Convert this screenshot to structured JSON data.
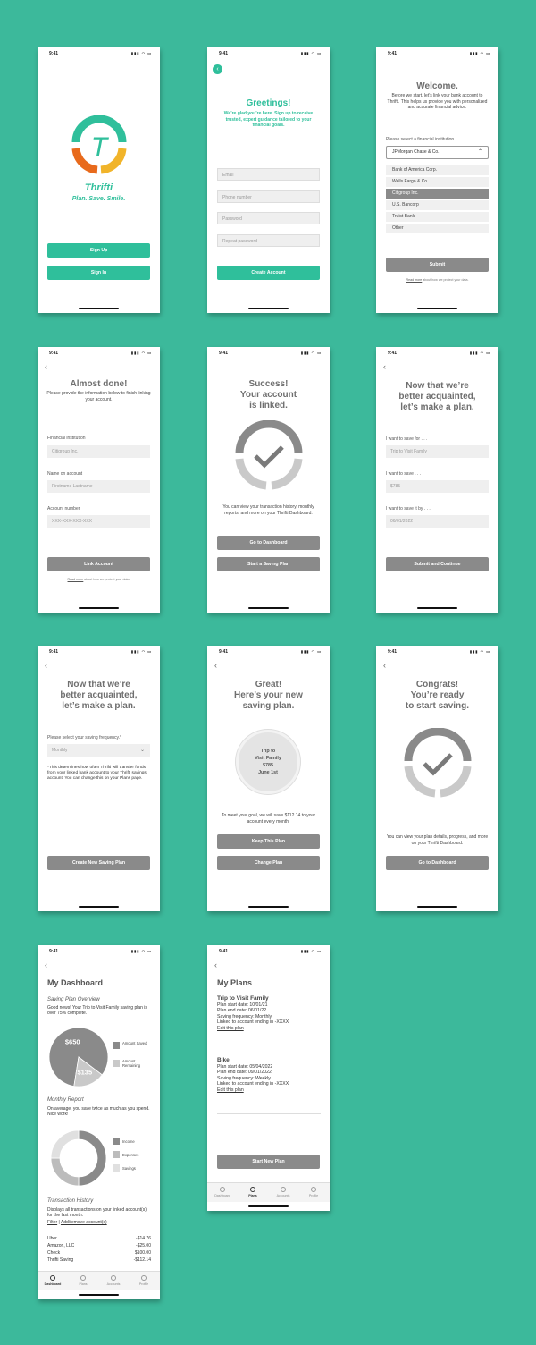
{
  "status": {
    "time": "9:41",
    "indicators": "▮▮▮ ◠ ▭"
  },
  "s1": {
    "logo_letter": "T",
    "app_name": "Thrifti",
    "tagline": "Plan. Save. Smile.",
    "signup": "Sign Up",
    "signin": "Sign In"
  },
  "s2": {
    "title": "Greetings!",
    "subtitle": "We’re glad you’re here. Sign up to receive trusted, expert guidance tailored to your financial goals.",
    "email": "Email",
    "phone": "Phone number",
    "password": "Password",
    "repeat": "Repeat password",
    "create": "Create Account"
  },
  "s3": {
    "title": "Welcome.",
    "intro": "Before we start, let’s link your bank account to Thrifti. This helps us provide you with personalized and accurate financial advice.",
    "select_label": "Please select a financial institution",
    "selected": "JPMorgan Chase & Co.",
    "options": [
      "Bank of America Corp.",
      "Wells Fargo & Co.",
      "Citigroup Inc.",
      "U.S. Bancorp",
      "Truist Bank",
      "Other"
    ],
    "submit": "Submit",
    "note_link": "Read more",
    "note_rest": " about how we protect your data."
  },
  "s4": {
    "title": "Almost done!",
    "intro": "Please provide the information below to finish linking your account.",
    "l1": "Financial institution",
    "v1": "Citigroup Inc.",
    "l2": "Name on account",
    "v2": "Firstname Lastname",
    "l3": "Account number",
    "v3": "XXX-XXX-XXX-XXX",
    "link": "Link Account",
    "note_link": "Read more",
    "note_rest": " about how we protect your data."
  },
  "s5": {
    "title1": "Success!",
    "title2": "Your account",
    "title3": "is linked.",
    "text": "You can view your transaction history, monthly reports, and more on your Thrifti Dashboard.",
    "dash": "Go to Dashboard",
    "start": "Start a Saving Plan"
  },
  "s6": {
    "title1": "Now that we’re",
    "title2": "better acquainted,",
    "title3": "let’s make a plan.",
    "l1": "I want to save for . . .",
    "v1": "Trip to Visit Family",
    "l2": "I want to save . . .",
    "v2": "$785",
    "l3": "I want to save it by . . .",
    "v3": "06/01/2022",
    "submit": "Submit and Continue"
  },
  "s7": {
    "title1": "Now that we’re",
    "title2": "better acquainted,",
    "title3": "let’s make a plan.",
    "label": "Please select your saving frequency.*",
    "value": "Monthly",
    "note": "*This determines how often Thrifti will transfer funds from your linked bank account to your Thrifti savings account. You can change this on your Plans page.",
    "create": "Create New Saving Plan"
  },
  "s8": {
    "title1": "Great!",
    "title2": "Here’s your new",
    "title3": "saving plan.",
    "c1": "Trip to",
    "c2": "Visit Family",
    "c3": "$785",
    "c4": "June 1st",
    "text": "To meet your goal, we will save $112.14 to your account every month.",
    "keep": "Keep This Plan",
    "change": "Change Plan"
  },
  "s9": {
    "title1": "Congrats!",
    "title2": "You’re ready",
    "title3": "to start saving.",
    "text": "You can view your plan details, progress, and more on your Thrifti Dashboard.",
    "dash": "Go to Dashboard"
  },
  "s10": {
    "title": "My Dashboard",
    "overview": "Saving Plan Overview",
    "overview_text": "Good news! Your Trip to Visit Family saving plan is over 75% complete.",
    "monthly": "Monthly Report",
    "monthly_text": "On average, you save twice as much as you spend. Nice work!",
    "history": "Transaction History",
    "history_text": "Displays all transactions on your linked account(s) for the last month.",
    "filter": "Filter",
    "sep": " | ",
    "add": "Add/remove account(s)",
    "transactions": [
      {
        "name": "Uber",
        "amount": "-$14.76"
      },
      {
        "name": "Amazon, LLC",
        "amount": "-$25.00"
      },
      {
        "name": "Check",
        "amount": "$100.00"
      },
      {
        "name": "Thrifti Saving",
        "amount": "-$112.14"
      }
    ],
    "tabs": [
      "Dashboard",
      "Plans",
      "Accounts",
      "Profile"
    ]
  },
  "s11": {
    "title": "My Plans",
    "plan1": {
      "name": "Trip to Visit Family",
      "l1": "Plan start date: 10/01/21",
      "l2": "Plan end date: 06/01/22",
      "l3": "Saving frequency: Monthly",
      "l4": "Linked to account ending in -XXXX",
      "edit": "Edit this plan"
    },
    "plan2": {
      "name": "Bike",
      "l1": "Plan start date: 05/04/2022",
      "l2": "Plan end date: 09/01/2022",
      "l3": "Saving frequency: Weekly",
      "l4": "Linked to account ending in -XXXX",
      "edit": "Edit this plan"
    },
    "new": "Start New Plan",
    "tabs": [
      "Dashboard",
      "Plans",
      "Accounts",
      "Profile"
    ]
  },
  "chart_data": [
    {
      "type": "pie",
      "categories": [
        "Amount Saved",
        "Amount Remaining"
      ],
      "values": [
        650,
        135
      ],
      "labels": [
        "$650",
        "$135"
      ],
      "colors": [
        "#8a8a8a",
        "#c9c9c9"
      ]
    },
    {
      "type": "pie",
      "categories": [
        "Income",
        "Expenses",
        "Savings"
      ],
      "values": [
        50,
        25,
        25
      ],
      "colors": [
        "#8a8a8a",
        "#bcbcbc",
        "#e0e0e0"
      ]
    }
  ]
}
